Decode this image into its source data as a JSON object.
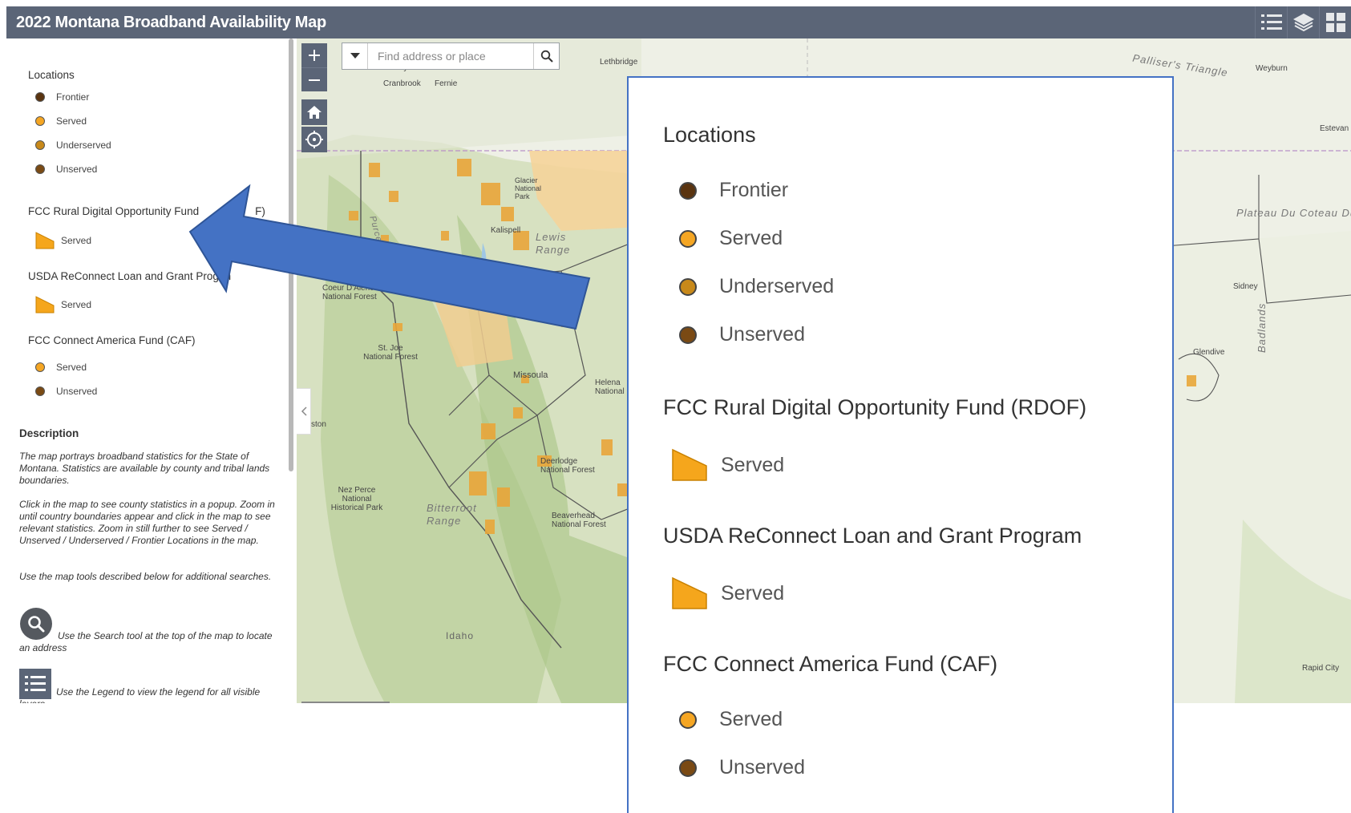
{
  "header": {
    "title": "2022 Montana Broadband Availability Map"
  },
  "colors": {
    "header_bg": "#5b6577",
    "frontier": "#5a3410",
    "served": "#f5a623",
    "underserved": "#c8891a",
    "unserved": "#7a4a14",
    "polygon_served": "#f5a61c",
    "arrow": "#4472c4"
  },
  "legend": {
    "locations": {
      "title": "Locations",
      "items": [
        "Frontier",
        "Served",
        "Underserved",
        "Unserved"
      ]
    },
    "rdof": {
      "title_full": "FCC Rural Digital Opportunity Fund (RDOF)",
      "title_partial_a": "FCC Rural Digital Opportunity Fund",
      "title_partial_b": "F)",
      "item": "Served"
    },
    "usda": {
      "title_full": "USDA ReConnect Loan and Grant Program",
      "title_partial_a": "USDA ReConnect Loan and Grant Prog",
      "title_partial_b": "m",
      "item": "Served"
    },
    "caf": {
      "title": "FCC Connect America Fund (CAF)",
      "items": [
        "Served",
        "Unserved"
      ]
    }
  },
  "description": {
    "title": "Description",
    "paragraphs": [
      "The map portrays broadband statistics for the State of Montana. Statistics are available by county and tribal lands boundaries.",
      "Click in the map to see county statistics in a popup. Zoom in until country boundaries appear and click in the map to see relevant statistics. Zoom in still further to see Served / Unserved / Underserved / Frontier Locations in the map.",
      "Use the map tools described below for additional searches.",
      "Use the Search tool at the top of the map to locate an address",
      "Use the Legend to view the legend for all visible layers"
    ]
  },
  "search": {
    "placeholder": "Find address or place"
  },
  "map_labels": {
    "lethbridge": "Lethbridge",
    "cranbrook": "Cranbrook",
    "fernie": "Fernie",
    "kimberley": "Kimberley",
    "kalispell": "Kalispell",
    "lewis_range": "Lewis Range",
    "coeur": "Coeur D'Alene National Forest",
    "st_joe": "St. Joe National Forest",
    "missoula": "Missoula",
    "helena": "Helena National",
    "nez_perce": "Nez Perce National Historical Park",
    "bitterroot": "Bitterroot Range",
    "deerlodge": "Deerlodge National Forest",
    "beaverhead": "Beaverhead National Forest",
    "idaho": "Idaho",
    "ston": "ston",
    "palliser": "Palliser's Triangle",
    "weyburn": "Weyburn",
    "estevan": "Estevan",
    "plateau": "Plateau Du Coteau Du",
    "sidney": "Sidney",
    "glendive": "Glendive",
    "badlands": "Badlands",
    "rapid_city": "Rapid City",
    "glacier": "Glacier National Park",
    "purcell": "Purcell Mounta"
  }
}
